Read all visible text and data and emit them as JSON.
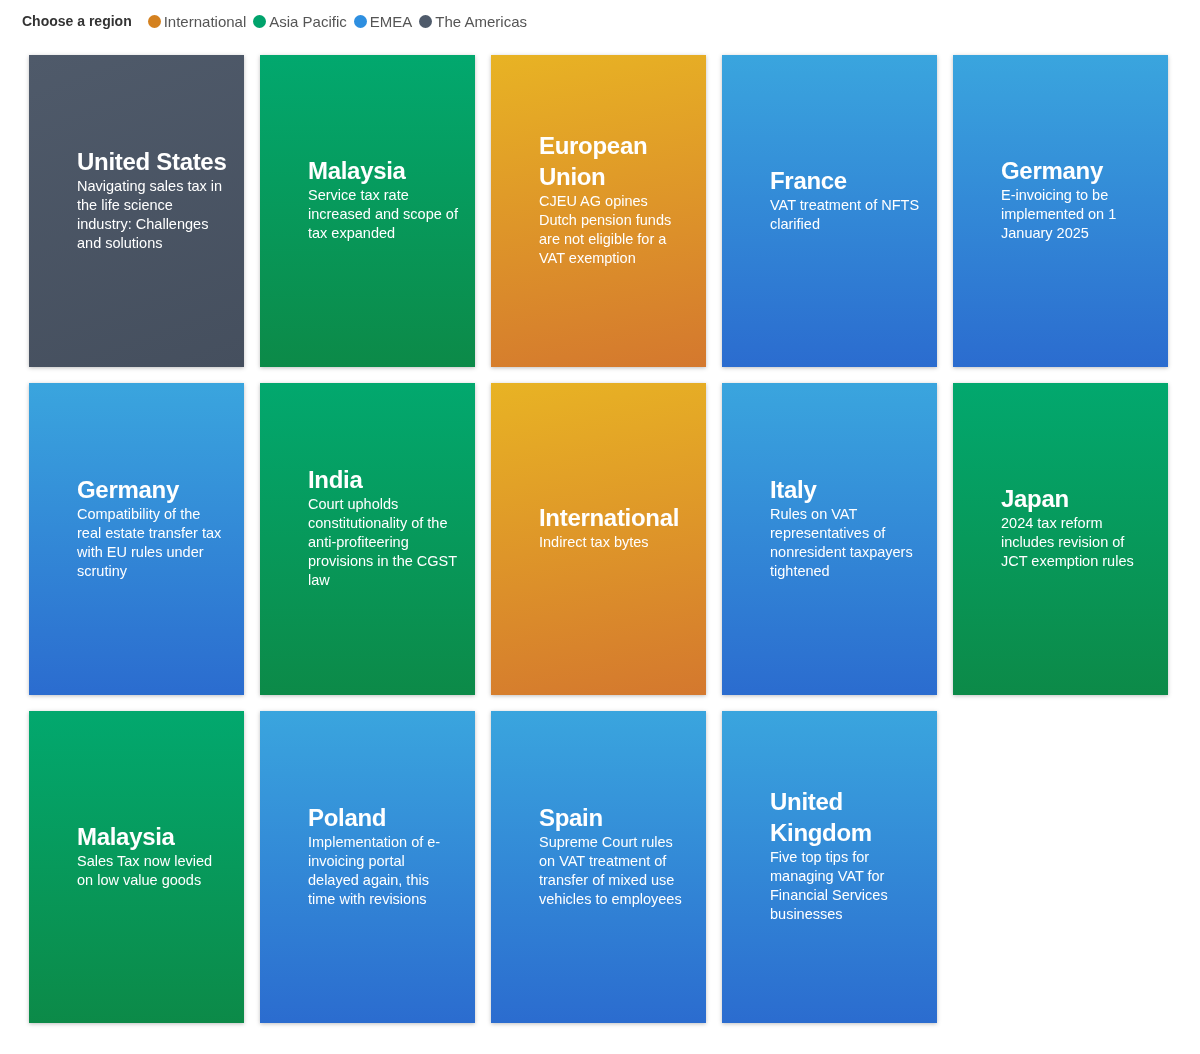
{
  "filter": {
    "label": "Choose a region",
    "regions": [
      {
        "label": "International",
        "color": "#d4811f"
      },
      {
        "label": "Asia Pacific",
        "color": "#00a36c"
      },
      {
        "label": "EMEA",
        "color": "#2e8fe0"
      },
      {
        "label": "The Americas",
        "color": "#4f5b6b"
      }
    ]
  },
  "cards": [
    {
      "kind": "americas",
      "title": "United States",
      "summary": "Navigating sales tax in the life science industry: Challenges and solutions"
    },
    {
      "kind": "asia",
      "title": "Malaysia",
      "summary": "Service tax rate increased and scope of tax expanded"
    },
    {
      "kind": "international",
      "title": "European Union",
      "summary": "CJEU AG opines Dutch pension funds are not eligible for a VAT exemption"
    },
    {
      "kind": "emea",
      "title": "France",
      "summary": "VAT treatment of NFTS clarified"
    },
    {
      "kind": "emea",
      "title": "Germany",
      "summary": "E-invoicing to be implemented on 1 January 2025"
    },
    {
      "kind": "emea",
      "title": "Germany",
      "summary": "Compatibility of the real estate transfer tax with EU rules under scrutiny"
    },
    {
      "kind": "asia",
      "title": "India",
      "summary": "Court upholds constitutionality of the anti-profiteering provisions in the CGST law"
    },
    {
      "kind": "international",
      "title": "International",
      "summary": "Indirect tax bytes"
    },
    {
      "kind": "emea",
      "title": "Italy",
      "summary": "Rules on VAT representatives of nonresident taxpayers tightened"
    },
    {
      "kind": "asia",
      "title": "Japan",
      "summary": "2024 tax reform includes revision of JCT exemption rules"
    },
    {
      "kind": "asia",
      "title": "Malaysia",
      "summary": "Sales Tax now levied on low value goods"
    },
    {
      "kind": "emea",
      "title": "Poland",
      "summary": "Implementation of e-invoicing portal delayed again, this time with revisions"
    },
    {
      "kind": "emea",
      "title": "Spain",
      "summary": "Supreme Court rules on VAT treatment of transfer of mixed use vehicles to employees"
    },
    {
      "kind": "emea",
      "title": "United Kingdom",
      "summary": "Five top tips for managing VAT for Financial Services businesses"
    }
  ]
}
